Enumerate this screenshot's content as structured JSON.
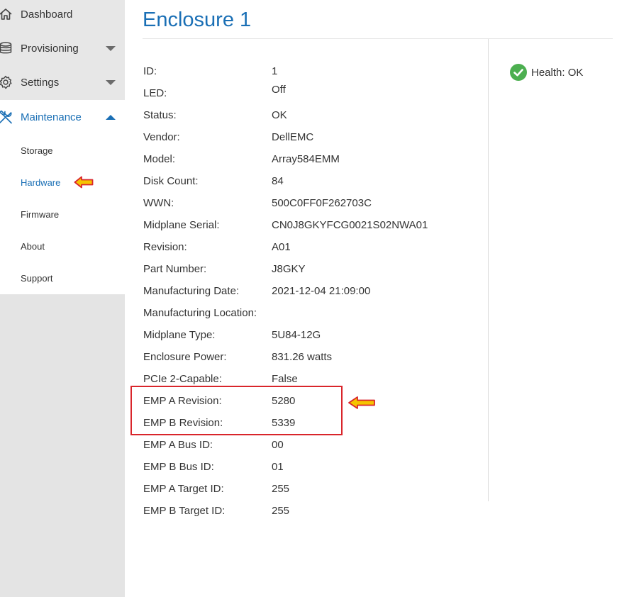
{
  "sidebar": {
    "items": [
      {
        "label": "Dashboard",
        "icon": "home-icon"
      },
      {
        "label": "Provisioning",
        "icon": "database-icon"
      },
      {
        "label": "Settings",
        "icon": "gear-icon"
      },
      {
        "label": "Maintenance",
        "icon": "wrench-screwdriver-icon"
      }
    ],
    "maintenance_sub": [
      "Storage",
      "Hardware",
      "Firmware",
      "About",
      "Support"
    ],
    "active_item": "Maintenance",
    "active_sub": "Hardware"
  },
  "page": {
    "title": "Enclosure 1",
    "health": "Health: OK"
  },
  "details": [
    {
      "key": "ID:",
      "value": "1"
    },
    {
      "key": "LED:",
      "value": "Off"
    },
    {
      "key": "Status:",
      "value": "OK"
    },
    {
      "key": "Vendor:",
      "value": "DellEMC"
    },
    {
      "key": "Model:",
      "value": "Array584EMM"
    },
    {
      "key": "Disk Count:",
      "value": "84"
    },
    {
      "key": "WWN:",
      "value": "500C0FF0F262703C"
    },
    {
      "key": "Midplane Serial:",
      "value": "CN0J8GKYFCG0021S02NWA01"
    },
    {
      "key": "Revision:",
      "value": "A01"
    },
    {
      "key": "Part Number:",
      "value": "J8GKY"
    },
    {
      "key": "Manufacturing Date:",
      "value": "2021-12-04 21:09:00"
    },
    {
      "key": "Manufacturing Location:",
      "value": ""
    },
    {
      "key": "Midplane Type:",
      "value": "5U84-12G"
    },
    {
      "key": "Enclosure Power:",
      "value": "831.26 watts"
    },
    {
      "key": "PCIe 2-Capable:",
      "value": "False"
    },
    {
      "key": "EMP A Revision:",
      "value": "5280"
    },
    {
      "key": "EMP B Revision:",
      "value": "5339"
    },
    {
      "key": "EMP A Bus ID:",
      "value": "00"
    },
    {
      "key": "EMP B Bus ID:",
      "value": "01"
    },
    {
      "key": "EMP A Target ID:",
      "value": "255"
    },
    {
      "key": "EMP B Target ID:",
      "value": "255"
    }
  ],
  "colors": {
    "accent": "#1a6fb5",
    "health_ok": "#4caf50",
    "highlight": "#d9252b",
    "arrow_fill": "#f5c400"
  }
}
